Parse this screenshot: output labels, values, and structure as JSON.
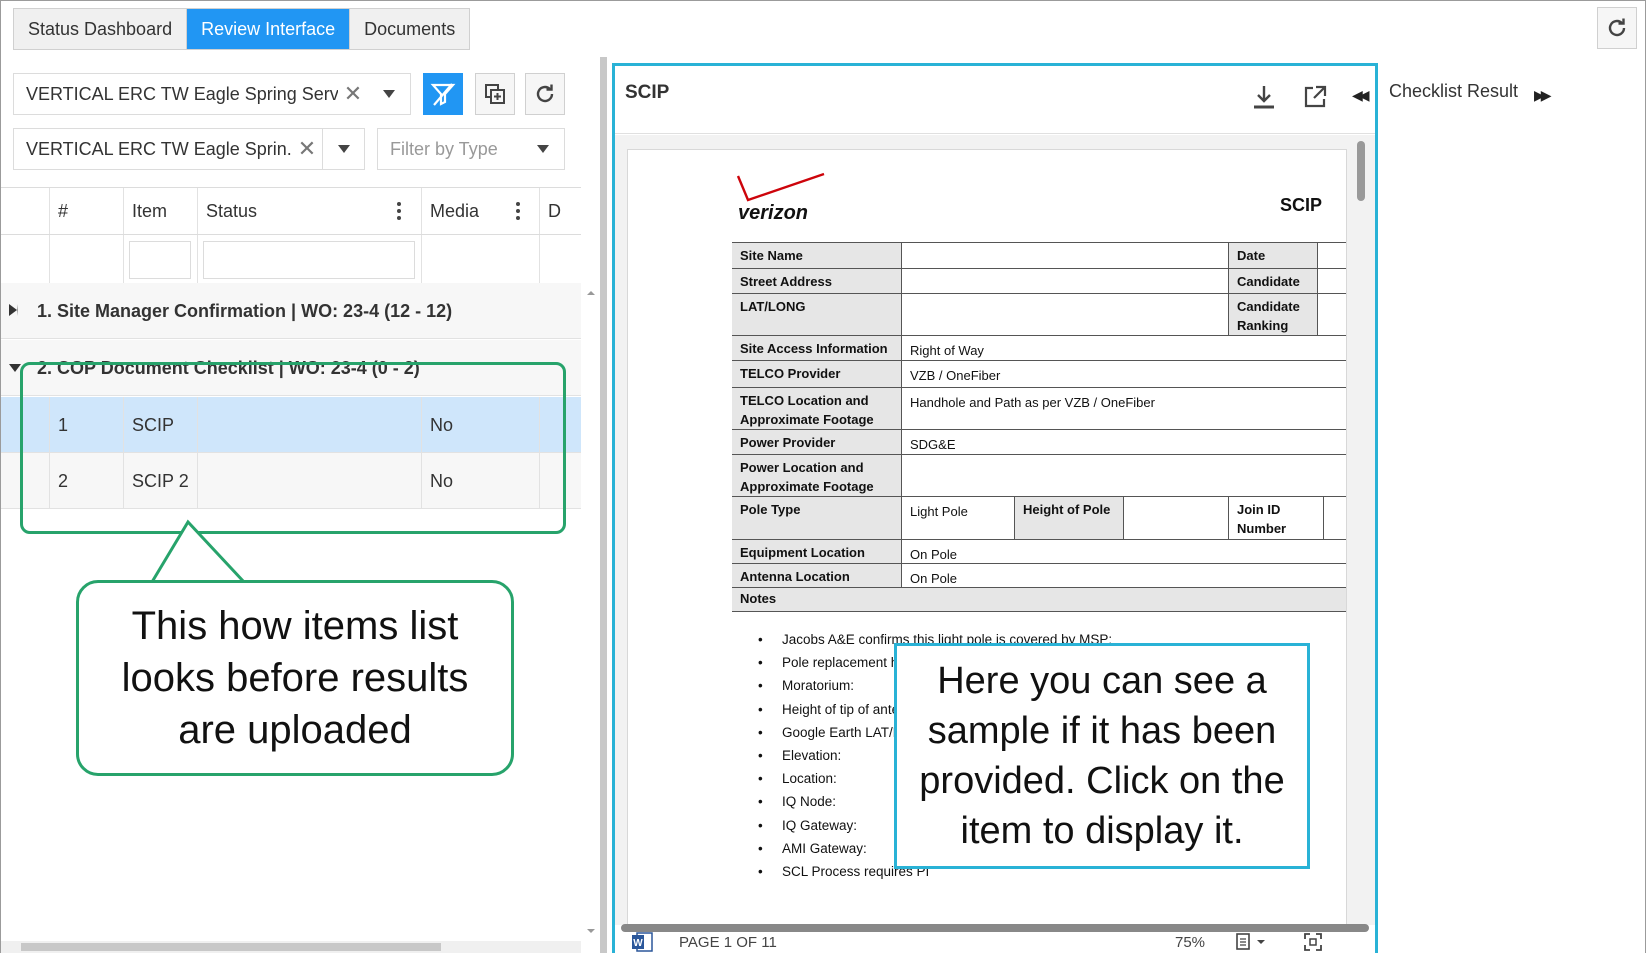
{
  "tabs": [
    {
      "label": "Status Dashboard",
      "active": false
    },
    {
      "label": "Review Interface",
      "active": true
    },
    {
      "label": "Documents",
      "active": false
    }
  ],
  "filters": {
    "project_value": "VERTICAL ERC TW Eagle Spring Serv...",
    "site_value": "VERTICAL ERC TW Eagle Sprin...",
    "type_placeholder": "Filter by Type"
  },
  "grid": {
    "columns": [
      "#",
      "Item",
      "Status",
      "Media",
      "D"
    ],
    "groups": [
      {
        "label": "1. Site Manager Confirmation | WO: 23-4  (12 - 12)",
        "expanded": false
      },
      {
        "label": "2. COP Document Checklist | WO: 23-4  (0 - 2)",
        "expanded": true
      }
    ],
    "rows": [
      {
        "num": "1",
        "item": "SCIP",
        "status": "",
        "media": "No",
        "selected": true
      },
      {
        "num": "2",
        "item": "SCIP 2",
        "status": "",
        "media": "No",
        "selected": false
      }
    ]
  },
  "callout_left": "This how items list looks before results are uploaded",
  "document": {
    "title": "SCIP",
    "logo_text": "verizon",
    "doc_heading": "SCIP",
    "fields": {
      "site_name": "Site Name",
      "date": "Date",
      "street_address": "Street Address",
      "candidate": "Candidate",
      "lat_long": "LAT/LONG",
      "candidate_ranking": "Candidate Ranking",
      "site_access_label": "Site Access Information",
      "site_access_value": "Right of Way",
      "telco_provider_label": "TELCO Provider",
      "telco_provider_value": "VZB / OneFiber",
      "telco_location_label": "TELCO Location and Approximate Footage",
      "telco_location_value": "Handhole and Path as per VZB / OneFiber",
      "power_provider_label": "Power Provider",
      "power_provider_value": "SDG&E",
      "power_location_label": "Power Location and Approximate Footage",
      "pole_type_label": "Pole Type",
      "pole_type_value": "Light Pole",
      "height_of_pole_label": "Height of Pole",
      "join_id_label": "Join ID Number",
      "equipment_location_label": "Equipment Location",
      "equipment_location_value": "On Pole",
      "antenna_location_label": "Antenna Location",
      "antenna_location_value": "On Pole",
      "notes_label": "Notes"
    },
    "notes": [
      "Jacobs A&E confirms this light pole is covered by MSP:",
      "Pole replacement height - **', Antenna RAD - **', Overall height - **'",
      "Moratorium:",
      "Height of tip of antenn",
      "Google Earth LAT/LON",
      "Elevation:",
      "Location:",
      "IQ Node:",
      "IQ Gateway:",
      "AMI Gateway:",
      "SCL Process requires PI"
    ],
    "footer": {
      "page": "PAGE 1 OF 11",
      "zoom": "75%"
    }
  },
  "callout_right": "Here you can see a sample if it has been provided. Click on the item to display it.",
  "right_panel": {
    "title": "Checklist Result"
  },
  "colors": {
    "accent": "#2196f3",
    "green": "#27a36b",
    "cyan": "#29b2d6",
    "selected_row": "#cfe6fb"
  }
}
